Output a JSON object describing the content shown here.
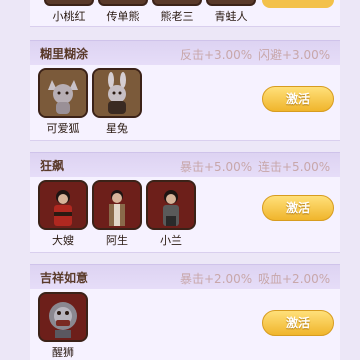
{
  "top_group": {
    "members": [
      "小桃红",
      "传单熊",
      "熊老三",
      "青蛙人"
    ]
  },
  "groups": [
    {
      "title": "糊里糊涂",
      "bonus1": "反击+3.00%",
      "bonus2": "闪避+3.00%",
      "members": [
        "可爱狐",
        "星兔"
      ],
      "activate_label": "激活"
    },
    {
      "title": "狂飙",
      "bonus1": "暴击+5.00%",
      "bonus2": "连击+5.00%",
      "members": [
        "大嫂",
        "阿生",
        "小兰"
      ],
      "activate_label": "激活"
    },
    {
      "title": "吉祥如意",
      "bonus1": "暴击+2.00%",
      "bonus2": "吸血+2.00%",
      "members": [
        "醒狮"
      ],
      "activate_label": "激活"
    }
  ],
  "colors": {
    "background": "#ece7f7",
    "header": "#ddd3f2",
    "bonus_text": "#c8a7aa",
    "activate_button": "#f0b52c"
  }
}
